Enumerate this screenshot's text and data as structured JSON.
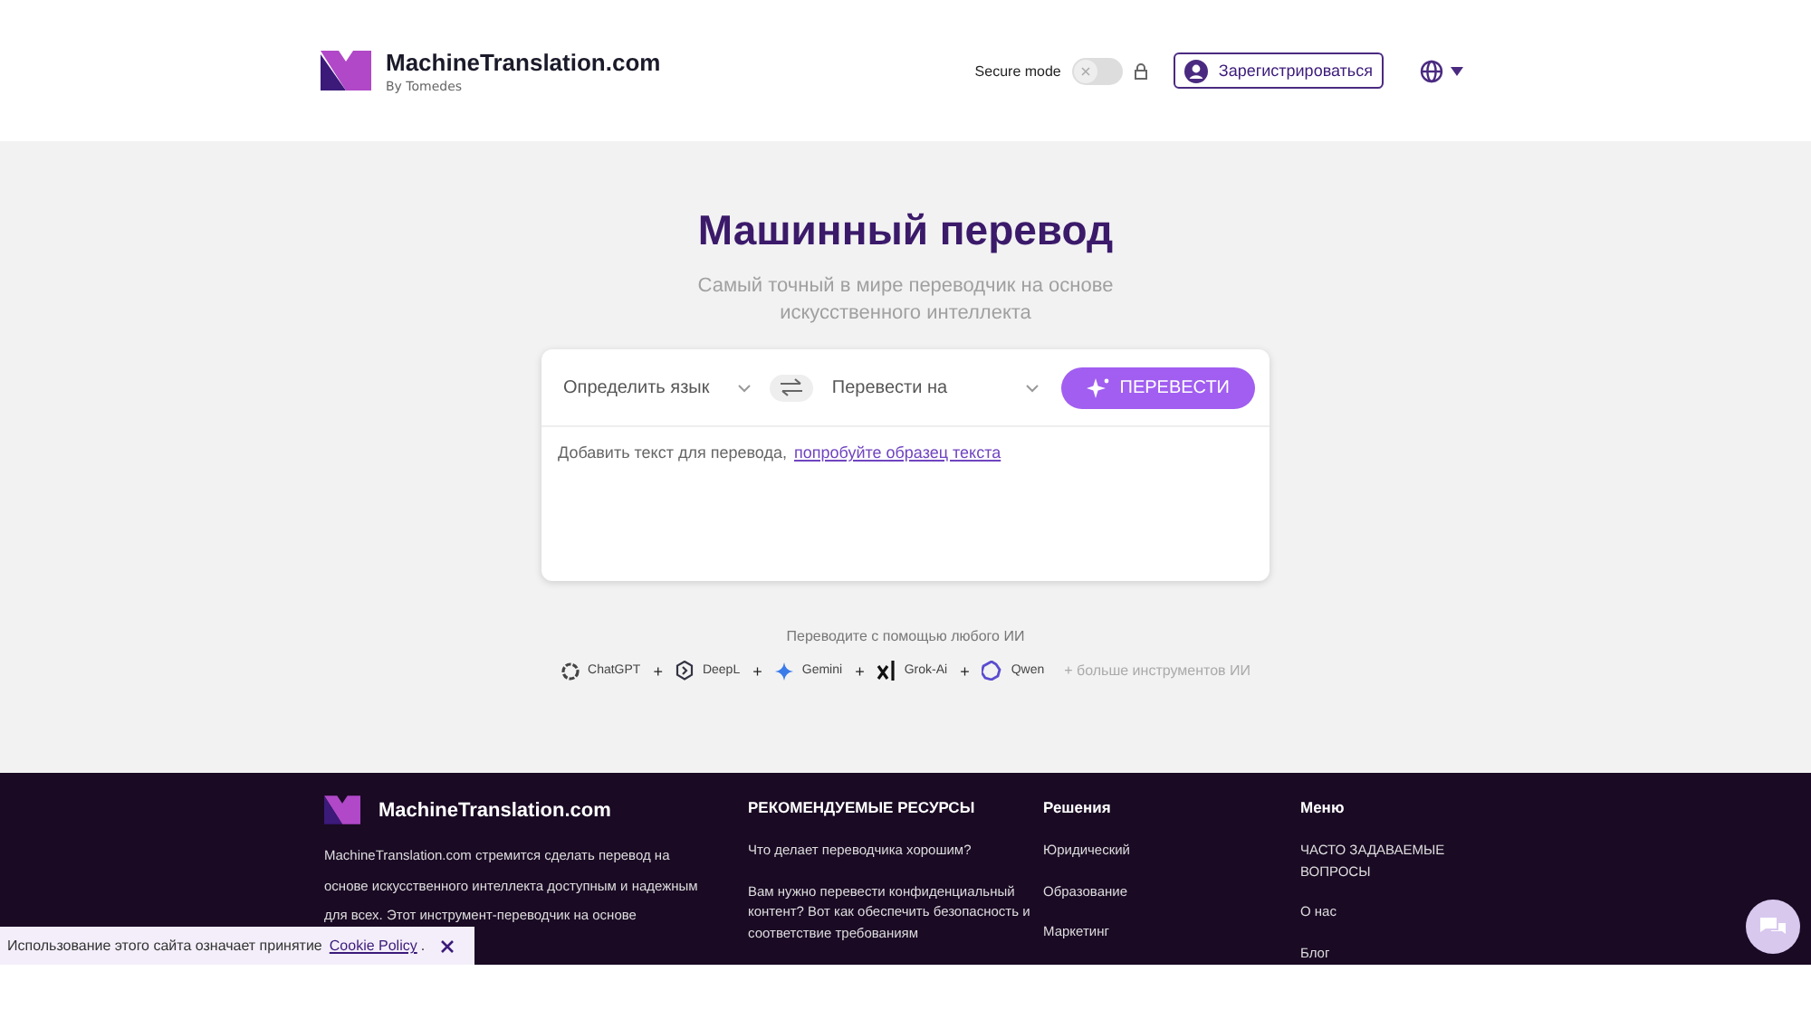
{
  "header": {
    "brand": "MachineTranslation.com",
    "brand_sub": "By Tomedes",
    "secure_mode": {
      "label": "Secure mode",
      "on": false
    },
    "register_button": "Зарегистрироваться"
  },
  "hero": {
    "title": "Машинный перевод",
    "subtitle": "Самый точный в мире переводчик на основе искусственного интеллекта"
  },
  "translator": {
    "source_language": "Определить язык",
    "target_language": "Перевести на",
    "translate_button": "ПЕРЕВЕСТИ",
    "placeholder": "Добавить текст для перевода,",
    "sample_link": "попробуйте образец текста"
  },
  "engines": {
    "caption": "Переводите с помощью любого ИИ",
    "items": [
      {
        "kind": "chatgpt",
        "label": "ChatGPT"
      },
      {
        "kind": "deepl",
        "label": "DeepL",
        "prefix": "+"
      },
      {
        "kind": "gemini",
        "label": "Gemini",
        "prefix": "+"
      },
      {
        "kind": "grok",
        "label": "Grok-Ai",
        "prefix": "+"
      },
      {
        "kind": "qwen",
        "label": "Qwen",
        "prefix": "+"
      }
    ],
    "more": "+ больше инструментов ИИ"
  },
  "footer": {
    "brand": "MachineTranslation.com",
    "description": "MachineTranslation.com стремится сделать перевод на основе искусственного интеллекта доступным и надежным для всех. Этот инструмент-переводчик на основе",
    "columns": [
      {
        "heading": "РЕКОМЕНДУЕМЫЕ РЕСУРСЫ",
        "links": [
          "Что делает переводчика хорошим?",
          "Вам нужно перевести конфиденциальный контент? Вот как обеспечить безопасность и соответствие требованиям"
        ]
      },
      {
        "heading": "Решения",
        "links": [
          "Юридический",
          "Образование",
          "Маркетинг"
        ]
      },
      {
        "heading": "Меню",
        "links": [
          "ЧАСТО ЗАДАВАЕМЫЕ ВОПРОСЫ",
          "О нас",
          "Блог"
        ]
      }
    ]
  },
  "cookie_bar": {
    "text": "Использование этого сайта означает принятие",
    "link": "Cookie Policy",
    "suffix": "."
  }
}
